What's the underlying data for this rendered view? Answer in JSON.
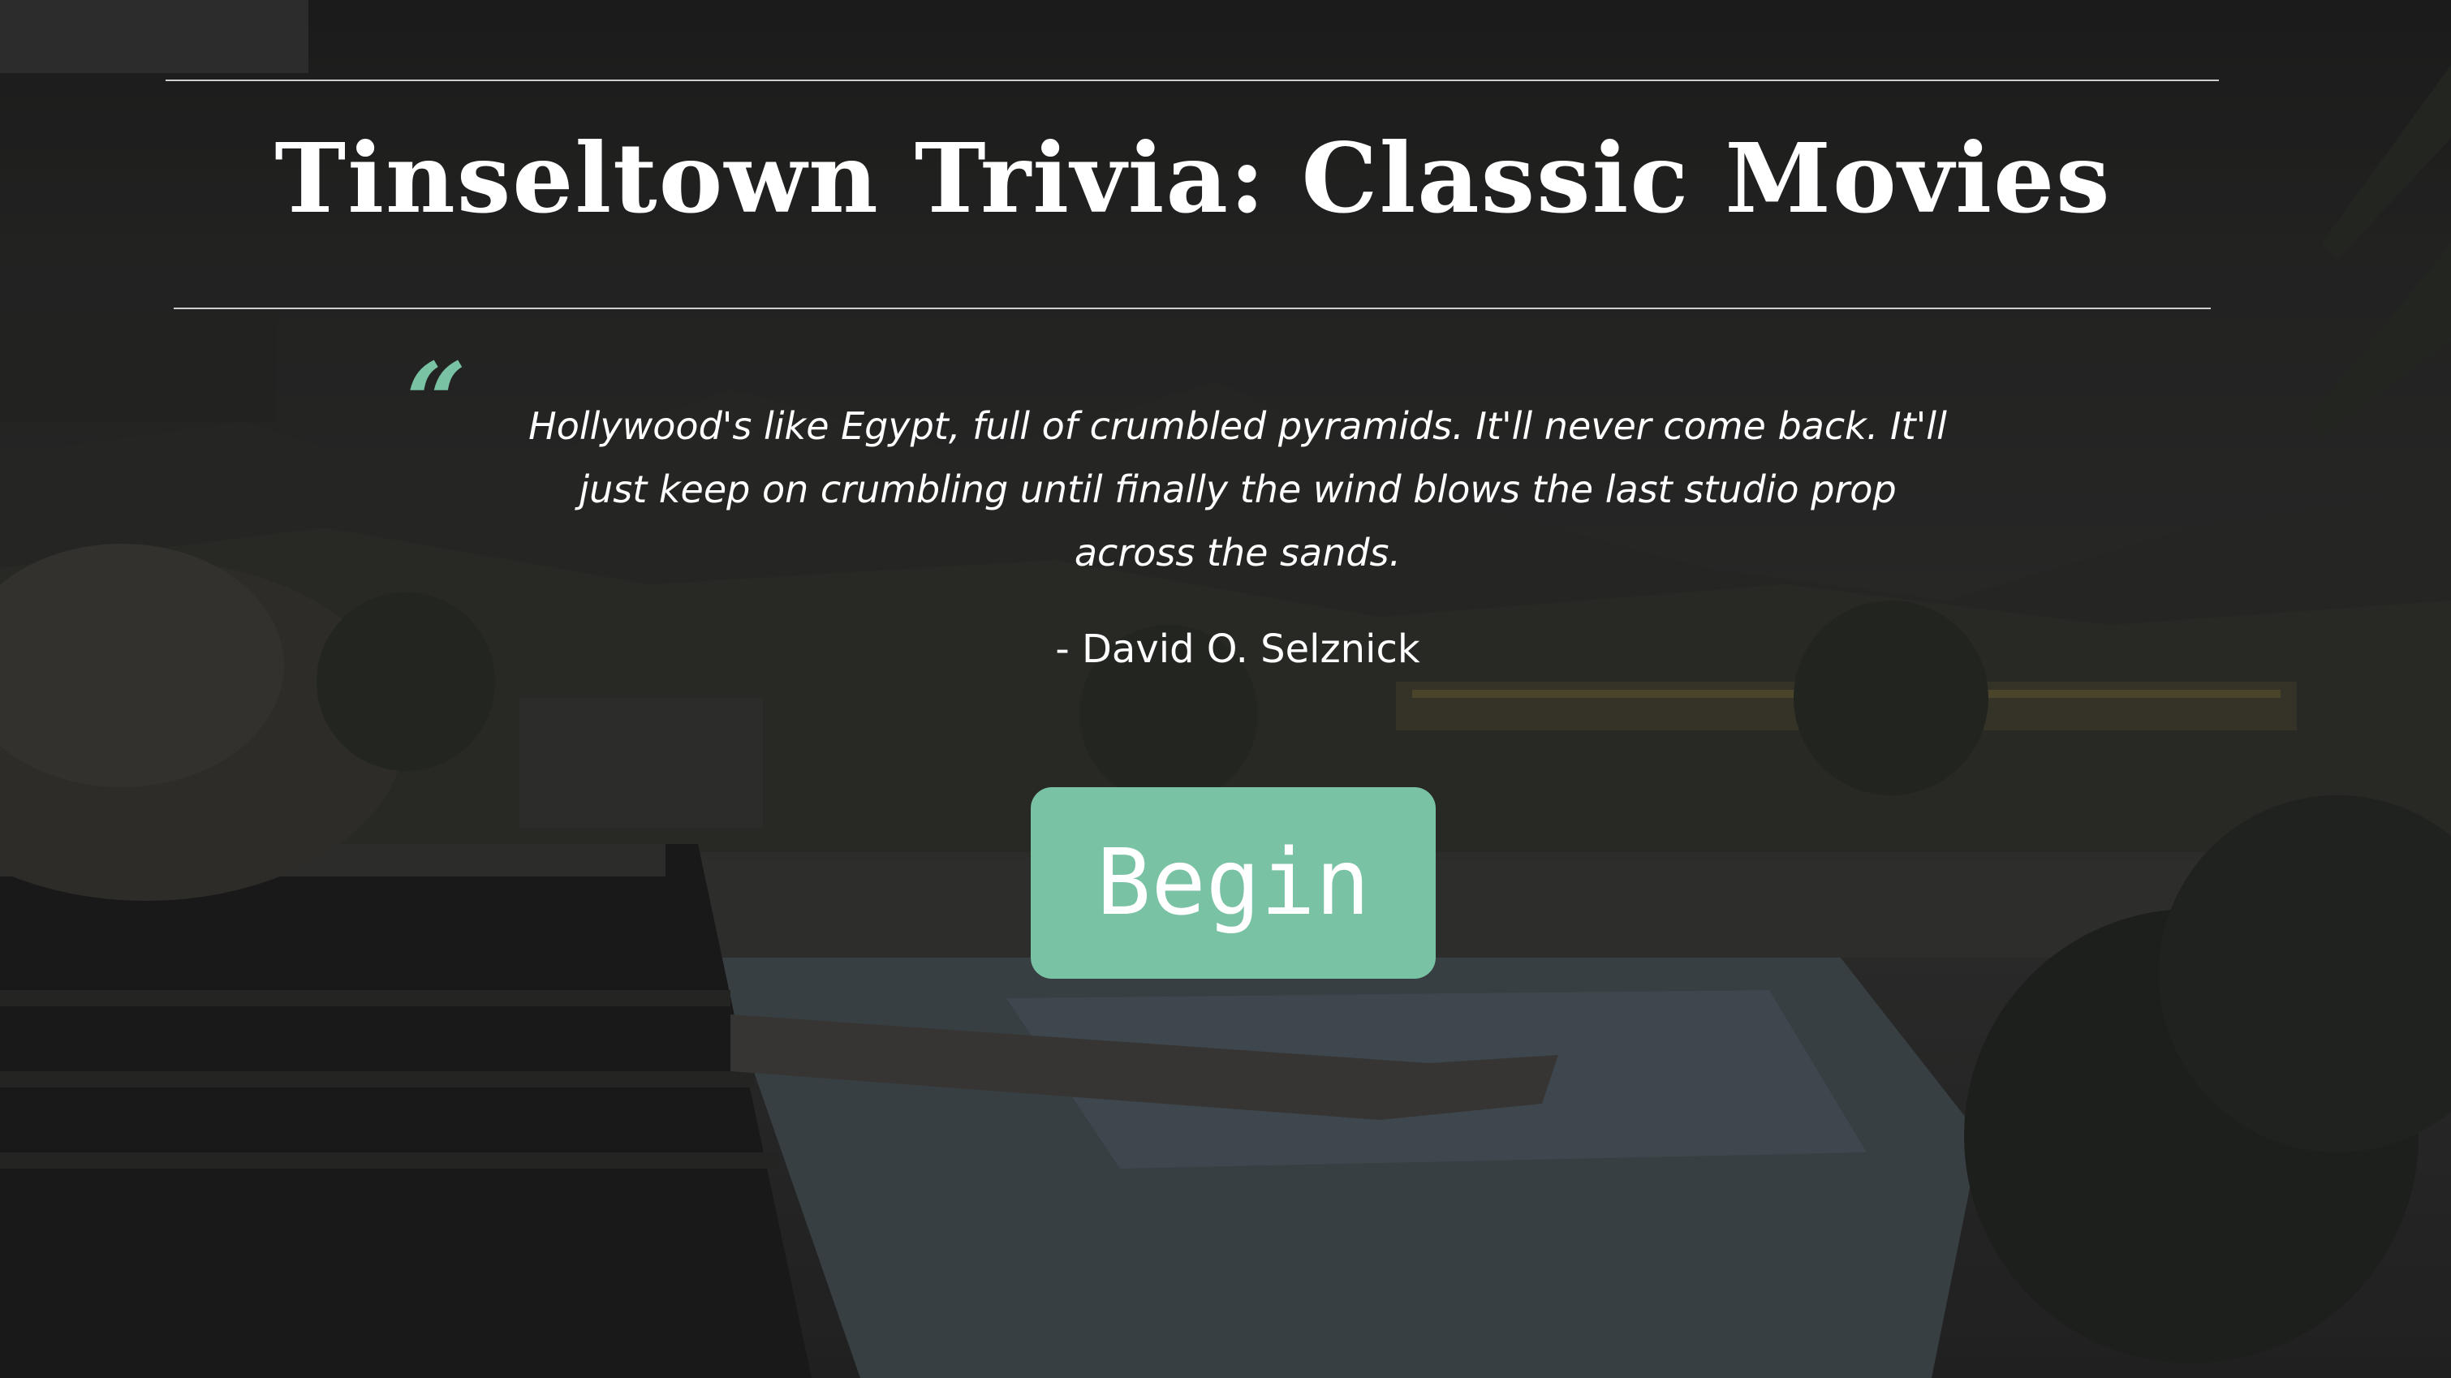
{
  "page": {
    "title": "Tinseltown Trivia: Classic Movies"
  },
  "quote": {
    "mark": "“",
    "text": "Hollywood's like Egypt, full of crumbled pyramids. It'll never come back. It'll just keep on crumbling until finally the wind blows the last studio prop across the sands.",
    "attribution": "- David O. Selznick"
  },
  "actions": {
    "begin_label": "Begin"
  },
  "colors": {
    "accent": "#79c2a4",
    "text": "#ffffff",
    "rule": "#cfcfcf",
    "background": "#2b2b2a"
  },
  "icons": {
    "quote_mark": "open-quote-icon"
  }
}
